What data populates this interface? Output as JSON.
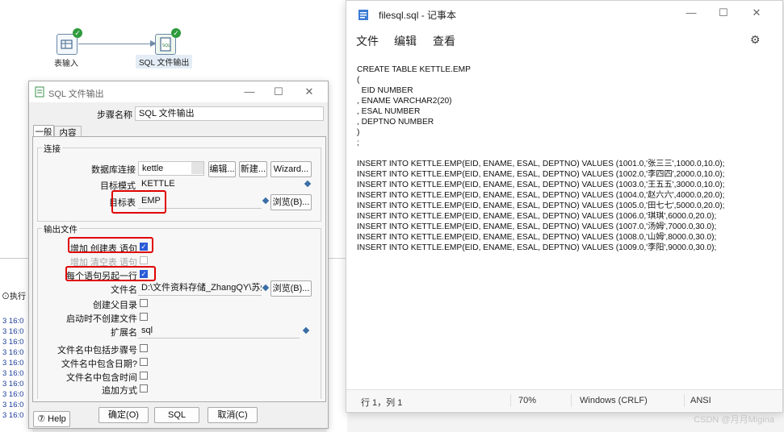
{
  "canvas": {
    "step1_label": "表输入",
    "step2_label": "SQL 文件输出",
    "check": "✓"
  },
  "log": {
    "tab_label": "执行",
    "lines": [
      "3 16:0",
      "3 16:0",
      "3 16:0",
      "3 16:0",
      "3 16:0",
      "3 16:0",
      "3 16:0",
      "3 16:0",
      "3 16:0",
      "3 16:0"
    ]
  },
  "dialog": {
    "title": "SQL 文件输出",
    "step_name_label": "步骤名称",
    "step_name_value": "SQL 文件输出",
    "tabs": [
      "一般",
      "内容"
    ],
    "connection_group": "连接",
    "db_conn_label": "数据库连接",
    "db_conn_value": "kettle",
    "edit_btn": "编辑...",
    "new_btn": "新建...",
    "wizard_btn": "Wizard...",
    "target_schema_label": "目标模式",
    "target_schema_value": "KETTLE",
    "target_table_label": "目标表",
    "target_table_value": "EMP",
    "browse_btn": "浏览(B)...",
    "output_group": "输出文件",
    "add_create_label": "增加 创建表 语句",
    "add_truncate_label": "增加 清空表 语句",
    "one_per_line_label": "每个语句另起一行",
    "filename_label": "文件名",
    "filename_value": "D:\\文件资料存储_ZhangQY\\苏州",
    "create_parent_label": "创建父目录",
    "no_create_label": "启动时不创建文件",
    "ext_label": "扩展名",
    "ext_value": "sql",
    "include_stepnr_label": "文件名中包括步骤号",
    "include_date_label": "文件名中包含日期?",
    "include_time_label": "文件名中包含时间",
    "append_label": "追加方式",
    "help_btn": "Help",
    "ok_btn": "确定(O)",
    "sql_btn": "SQL",
    "cancel_btn": "取消(C)",
    "min_icon": "—",
    "max_icon": "☐",
    "close_icon": "✕"
  },
  "notepad": {
    "title": "filesql.sql - 记事本",
    "menu": [
      "文件",
      "编辑",
      "查看"
    ],
    "content": "CREATE TABLE KETTLE.EMP\n(\n  EID NUMBER\n, ENAME VARCHAR2(20)\n, ESAL NUMBER\n, DEPTNO NUMBER\n)\n;\n\nINSERT INTO KETTLE.EMP(EID, ENAME, ESAL, DEPTNO) VALUES (1001.0,'张三三',1000.0,10.0);\nINSERT INTO KETTLE.EMP(EID, ENAME, ESAL, DEPTNO) VALUES (1002.0,'李四四',2000.0,10.0);\nINSERT INTO KETTLE.EMP(EID, ENAME, ESAL, DEPTNO) VALUES (1003.0,'王五五',3000.0,10.0);\nINSERT INTO KETTLE.EMP(EID, ENAME, ESAL, DEPTNO) VALUES (1004.0,'赵六六',4000.0,20.0);\nINSERT INTO KETTLE.EMP(EID, ENAME, ESAL, DEPTNO) VALUES (1005.0,'田七七',5000.0,20.0);\nINSERT INTO KETTLE.EMP(EID, ENAME, ESAL, DEPTNO) VALUES (1006.0,'琪琪',6000.0,20.0);\nINSERT INTO KETTLE.EMP(EID, ENAME, ESAL, DEPTNO) VALUES (1007.0,'汤姆',7000.0,30.0);\nINSERT INTO KETTLE.EMP(EID, ENAME, ESAL, DEPTNO) VALUES (1008.0,'山姆',8000.0,30.0);\nINSERT INTO KETTLE.EMP(EID, ENAME, ESAL, DEPTNO) VALUES (1009.0,'李阳',9000.0,30.0);",
    "status": {
      "position": "行 1，列 1",
      "zoom": "70%",
      "line_ending": "Windows (CRLF)",
      "encoding": "ANSI"
    },
    "min_icon": "—",
    "max_icon": "☐",
    "close_icon": "✕",
    "gear_icon": "⚙"
  },
  "watermark": "CSDN @月月Migina",
  "colors": {
    "highlight_red": "#e00000",
    "check_blue": "#2a5bd7",
    "check_green": "#2e9b3d"
  }
}
